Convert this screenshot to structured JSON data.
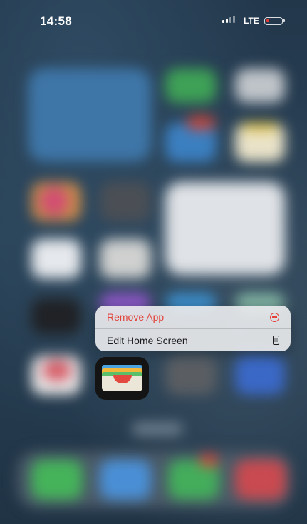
{
  "status_bar": {
    "time": "14:58",
    "network": "LTE",
    "battery_color": "#e53935"
  },
  "context_menu": {
    "items": [
      {
        "label": "Remove App",
        "icon": "remove-circle-icon",
        "color": "#e4413a"
      },
      {
        "label": "Edit Home Screen",
        "icon": "phone-screen-icon",
        "color": "#1c1c1e"
      }
    ]
  },
  "focused_app": {
    "icon": "wallet-icon"
  }
}
